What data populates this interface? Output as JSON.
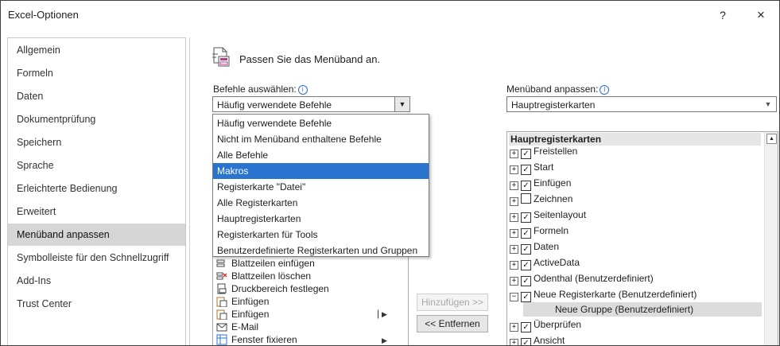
{
  "window": {
    "title": "Excel-Optionen",
    "help_label": "?",
    "close_label": "×"
  },
  "nav": {
    "items": [
      {
        "label": "Allgemein"
      },
      {
        "label": "Formeln"
      },
      {
        "label": "Daten"
      },
      {
        "label": "Dokumentprüfung"
      },
      {
        "label": "Speichern"
      },
      {
        "label": "Sprache"
      },
      {
        "label": "Erleichterte Bedienung"
      },
      {
        "label": "Erweitert"
      },
      {
        "label": "Menüband anpassen"
      },
      {
        "label": "Symbolleiste für den Schnellzugriff"
      },
      {
        "label": "Add-Ins"
      },
      {
        "label": "Trust Center"
      }
    ],
    "selected": "Menüband anpassen"
  },
  "header": {
    "text": "Passen Sie das Menüband an.",
    "icon": "customize-ribbon-icon"
  },
  "commands": {
    "label": "Befehle auswählen:",
    "selected_value": "Häufig verwendete Befehle",
    "dropdown_options": [
      {
        "label": "Häufig verwendete Befehle"
      },
      {
        "label": "Nicht im Menüband enthaltene Befehle"
      },
      {
        "label": "Alle Befehle"
      },
      {
        "label": "Makros"
      },
      {
        "label": "Registerkarte \"Datei\""
      },
      {
        "label": "Alle Registerkarten"
      },
      {
        "label": "Hauptregisterkarten"
      },
      {
        "label": "Registerkarten für Tools"
      },
      {
        "label": "Benutzerdefinierte Registerkarten und Gruppen"
      }
    ],
    "highlighted_option": "Makros",
    "list_items": [
      {
        "label": "Blattzeilen einfügen",
        "icon": "insert-rows-icon"
      },
      {
        "label": "Blattzeilen löschen",
        "icon": "delete-rows-icon"
      },
      {
        "label": "Druckbereich festlegen",
        "icon": "print-area-icon"
      },
      {
        "label": "Einfügen",
        "icon": "paste-icon"
      },
      {
        "label": "Einfügen",
        "icon": "paste-icon",
        "has_split": true
      },
      {
        "label": "E-Mail",
        "icon": "email-icon"
      },
      {
        "label": "Fenster fixieren",
        "icon": "freeze-panes-icon",
        "has_submenu": true
      }
    ]
  },
  "buttons": {
    "add": "Hinzufügen >>",
    "remove": "<< Entfernen"
  },
  "ribbon": {
    "label": "Menüband anpassen:",
    "selected_value": "Hauptregisterkarten",
    "tree_header": "Hauptregisterkarten",
    "tree_items": [
      {
        "label": "Freistellen",
        "checked": true,
        "expanded": false
      },
      {
        "label": "Start",
        "checked": true,
        "expanded": false
      },
      {
        "label": "Einfügen",
        "checked": true,
        "expanded": false
      },
      {
        "label": "Zeichnen",
        "checked": false,
        "expanded": false
      },
      {
        "label": "Seitenlayout",
        "checked": true,
        "expanded": false
      },
      {
        "label": "Formeln",
        "checked": true,
        "expanded": false
      },
      {
        "label": "Daten",
        "checked": true,
        "expanded": false
      },
      {
        "label": "ActiveData",
        "checked": true,
        "expanded": false
      },
      {
        "label": "Odenthal (Benutzerdefiniert)",
        "checked": true,
        "expanded": false
      },
      {
        "label": "Neue Registerkarte (Benutzerdefiniert)",
        "checked": true,
        "expanded": true
      },
      {
        "label": "Überprüfen",
        "checked": true,
        "expanded": false
      },
      {
        "label": "Ansicht",
        "checked": true,
        "expanded": false
      }
    ],
    "sub_item": "Neue Gruppe (Benutzerdefiniert)"
  }
}
